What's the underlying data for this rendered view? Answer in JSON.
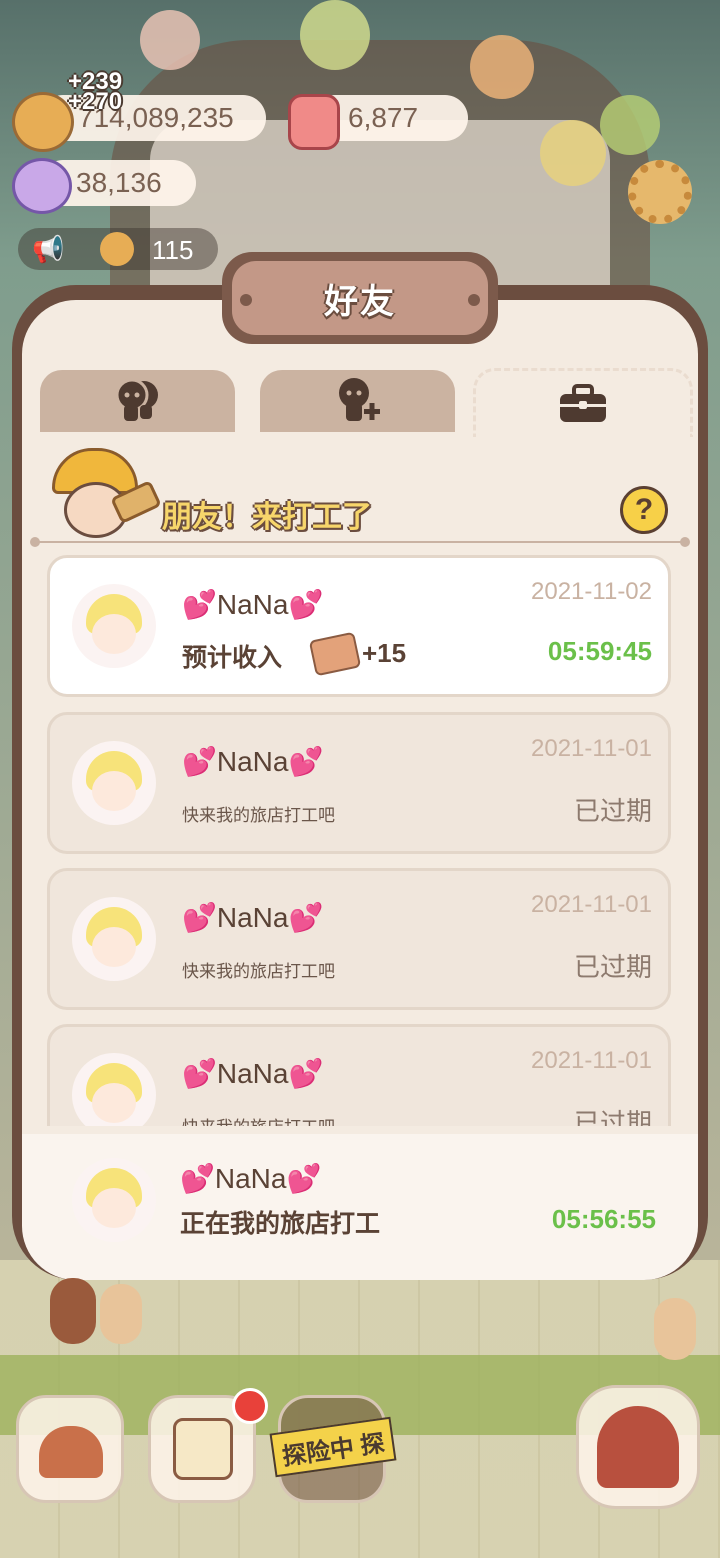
{
  "resources": {
    "cookies": {
      "value": "714,089,235",
      "gains": [
        "+239",
        "+270"
      ]
    },
    "jelly": {
      "value": "6,877"
    },
    "candy": {
      "value": "38,136"
    },
    "visitors": {
      "value": "115"
    }
  },
  "dialog": {
    "title": "好友",
    "tabs": [
      {
        "icon": "friends-icon",
        "active": false
      },
      {
        "icon": "add-friend-icon",
        "active": false
      },
      {
        "icon": "briefcase-icon",
        "active": true
      }
    ],
    "banner": "朋友！来打工了",
    "items": [
      {
        "name": "💕NaNa💕",
        "date": "2021-11-02",
        "status": "active",
        "subtitle": "预计收入",
        "reward": "+15",
        "timer": "05:59:45"
      },
      {
        "name": "💕NaNa💕",
        "date": "2021-11-01",
        "status": "expired",
        "subtitle": "快来我的旅店打工吧",
        "state_label": "已过期"
      },
      {
        "name": "💕NaNa💕",
        "date": "2021-11-01",
        "status": "expired",
        "subtitle": "快来我的旅店打工吧",
        "state_label": "已过期"
      },
      {
        "name": "💕NaNa💕",
        "date": "2021-11-01",
        "status": "expired",
        "subtitle": "快来我的旅店打工吧",
        "state_label": "已过期"
      }
    ],
    "footer": {
      "name": "💕NaNa💕",
      "status": "正在我的旅店打工",
      "timer": "05:56:55"
    }
  },
  "bottom_nav": {
    "explore_label": "探险中 探"
  },
  "colors": {
    "accent_green": "#6bc04a",
    "brown": "#6b4d3f",
    "banner_yellow": "#f7d66b"
  }
}
